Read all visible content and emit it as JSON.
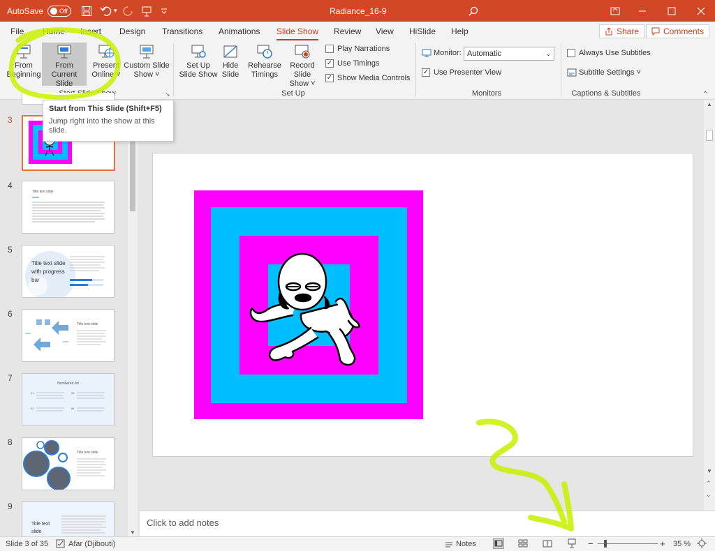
{
  "titlebar": {
    "autosave_label": "AutoSave",
    "autosave_state": "Off",
    "document_title": "Radiance_16-9"
  },
  "tabs": [
    "File",
    "Home",
    "Insert",
    "Design",
    "Transitions",
    "Animations",
    "Slide Show",
    "Review",
    "View",
    "HiSlide",
    "Help"
  ],
  "active_tab": "Slide Show",
  "share_label": "Share",
  "comments_label": "Comments",
  "ribbon": {
    "from_beginning": [
      "From",
      "Beginning"
    ],
    "from_current": [
      "From",
      "Current Slide"
    ],
    "present_online": [
      "Present",
      "Online ˅"
    ],
    "custom_slide_show": [
      "Custom Slide",
      "Show ˅"
    ],
    "group_start": "Start Slide Show",
    "set_up_slide_show": [
      "Set Up",
      "Slide Show"
    ],
    "hide_slide": [
      "Hide",
      "Slide"
    ],
    "rehearse_timings": [
      "Rehearse",
      "Timings"
    ],
    "record_slide_show": [
      "Record Slide",
      "Show ˅"
    ],
    "play_narrations": "Play Narrations",
    "use_timings": "Use Timings",
    "show_media_controls": "Show Media Controls",
    "group_setup": "Set Up",
    "monitor_label": "Monitor:",
    "monitor_value": "Automatic",
    "use_presenter_view": "Use Presenter View",
    "group_monitors": "Monitors",
    "always_use_subtitles": "Always Use Subtitles",
    "subtitle_settings": "Subtitle Settings ˅",
    "group_captions": "Captions & Subtitles"
  },
  "checkbox_states": {
    "play_narrations": false,
    "use_timings": true,
    "show_media_controls": true,
    "use_presenter_view": true,
    "always_use_subtitles": false
  },
  "tooltip": {
    "title": "Start from This Slide (Shift+F5)",
    "body": "Jump right into the show at this slide."
  },
  "slides": [
    {
      "num": "3",
      "kind": "image"
    },
    {
      "num": "4",
      "title": "Title text slide"
    },
    {
      "num": "5",
      "title": "Title text slide with progress bar"
    },
    {
      "num": "6",
      "title": "Title text slide"
    },
    {
      "num": "7",
      "title": "Numbered list"
    },
    {
      "num": "8",
      "title": "Title text slide"
    },
    {
      "num": "9",
      "title": "Title text slide"
    }
  ],
  "numbered_list_items": [
    "01",
    "02",
    "03",
    "04"
  ],
  "notes_placeholder": "Click to add notes",
  "status": {
    "slide_counter": "Slide 3 of 35",
    "language": "Afar (Djibouti)",
    "notes_label": "Notes",
    "zoom": "35 %"
  },
  "colors": {
    "accent": "#d24726",
    "magenta": "#ff00ff",
    "cyan": "#00bfff",
    "highlighter": "#c8f000"
  }
}
